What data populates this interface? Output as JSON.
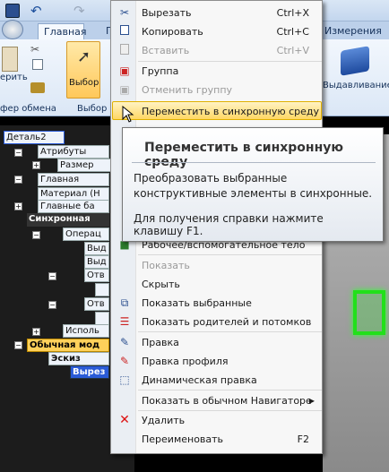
{
  "ribbon": {
    "tabs": [
      "Главная",
      "П",
      "Измерения"
    ],
    "groups": {
      "clipboard_fragment": "ерить",
      "clipboard_label": "фер обмена",
      "select_label": "Выбор",
      "select_group_fragment": "Выбор",
      "extrude_label": "Выдавливание"
    }
  },
  "tree": {
    "items": [
      {
        "label": "Деталь2"
      },
      {
        "label": "Атрибуты"
      },
      {
        "label": "Размер"
      },
      {
        "label": "Главная"
      },
      {
        "label": "Материал (Н"
      },
      {
        "label": "Главные ба"
      },
      {
        "label": "Синхронная"
      },
      {
        "label": "Операц"
      },
      {
        "label": "Выд"
      },
      {
        "label": "Выд"
      },
      {
        "label": "Отв"
      },
      {
        "label": "Отв"
      },
      {
        "label": "Исполь"
      },
      {
        "label": "Обычная мод"
      },
      {
        "label": "Эскиз"
      },
      {
        "label": "Вырез"
      }
    ]
  },
  "menu": {
    "items": [
      {
        "label": "Вырезать",
        "shortcut": "Ctrl+X",
        "icon": "scissors-icon",
        "disabled": false
      },
      {
        "label": "Копировать",
        "shortcut": "Ctrl+C",
        "icon": "copy-icon",
        "disabled": false
      },
      {
        "label": "Вставить",
        "shortcut": "Ctrl+V",
        "icon": "paste-icon",
        "disabled": true
      },
      {
        "label": "Группа",
        "shortcut": "",
        "icon": "group-icon",
        "disabled": false
      },
      {
        "label": "Отменить группу",
        "shortcut": "",
        "icon": "ungroup-icon",
        "disabled": true
      },
      {
        "label": "Переместить в синхронную среду",
        "shortcut": "",
        "icon": "",
        "disabled": false,
        "highlighted": true
      },
      {
        "label": "Рабочее/вспомогательное тело",
        "shortcut": "",
        "icon": "body-icon",
        "disabled": false
      },
      {
        "label": "Показать",
        "shortcut": "",
        "icon": "",
        "disabled": true
      },
      {
        "label": "Скрыть",
        "shortcut": "",
        "icon": "",
        "disabled": false
      },
      {
        "label": "Показать выбранные",
        "shortcut": "",
        "icon": "show-selected-icon",
        "disabled": false
      },
      {
        "label": "Показать родителей и потомков",
        "shortcut": "",
        "icon": "parents-children-icon",
        "disabled": false
      },
      {
        "label": "Правка",
        "shortcut": "",
        "icon": "edit-icon",
        "disabled": false
      },
      {
        "label": "Правка профиля",
        "shortcut": "",
        "icon": "edit-profile-icon",
        "disabled": false
      },
      {
        "label": "Динамическая правка",
        "shortcut": "",
        "icon": "dynamic-edit-icon",
        "disabled": false
      },
      {
        "label": "Показать в обычном Навигаторе",
        "shortcut": "",
        "icon": "",
        "disabled": false,
        "submenu": true
      },
      {
        "label": "Удалить",
        "shortcut": "",
        "icon": "delete-icon",
        "disabled": false
      },
      {
        "label": "Переименовать",
        "shortcut": "F2",
        "icon": "",
        "disabled": false
      }
    ]
  },
  "tooltip": {
    "title": "Переместить в синхронную среду",
    "description": "Преобразовать выбранные конструктивные элементы в синхронные.",
    "help": "Для получения справки нажмите клавишу F1."
  },
  "colors": {
    "highlight": "#ffd764",
    "accent": "#2a5bd7",
    "delete": "#d11",
    "green_model": "#22e01a"
  }
}
